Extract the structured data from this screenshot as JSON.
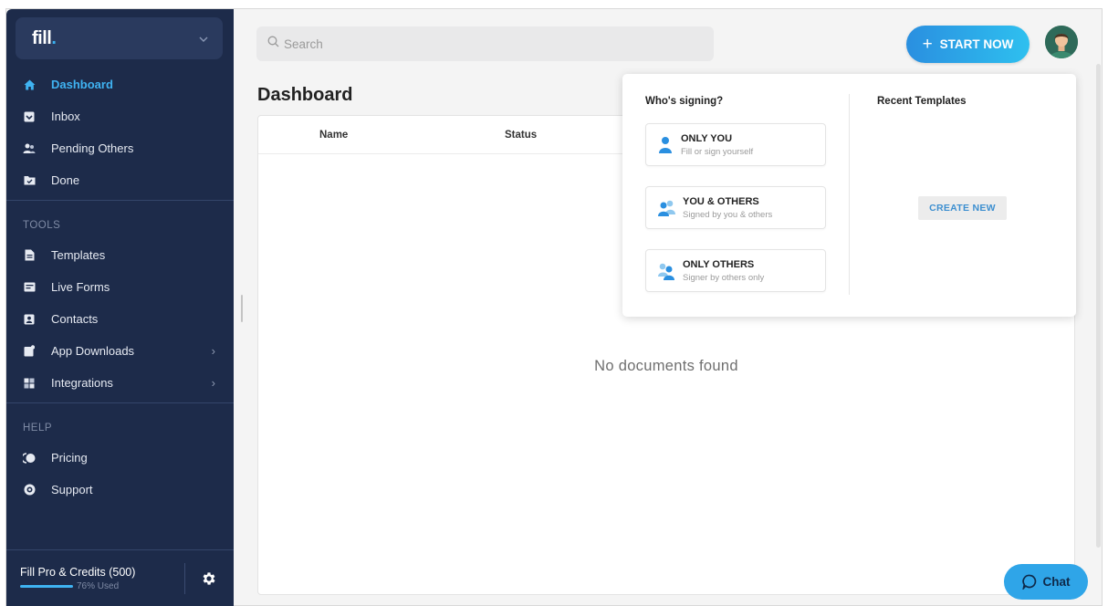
{
  "brand": {
    "logo_text": "fill",
    "logo_dot": "."
  },
  "sidebar": {
    "main_items": [
      {
        "label": "Dashboard",
        "icon": "home-icon",
        "active": true
      },
      {
        "label": "Inbox",
        "icon": "inbox-icon"
      },
      {
        "label": "Pending Others",
        "icon": "users-icon"
      },
      {
        "label": "Done",
        "icon": "folder-check-icon"
      }
    ],
    "tools_title": "TOOLS",
    "tools_items": [
      {
        "label": "Templates",
        "icon": "document-icon"
      },
      {
        "label": "Live Forms",
        "icon": "form-icon"
      },
      {
        "label": "Contacts",
        "icon": "contact-icon"
      },
      {
        "label": "App Downloads",
        "icon": "download-icon",
        "chevron": "›"
      },
      {
        "label": "Integrations",
        "icon": "puzzle-icon",
        "chevron": "›"
      }
    ],
    "help_title": "HELP",
    "help_items": [
      {
        "label": "Pricing",
        "icon": "pricing-icon"
      },
      {
        "label": "Support",
        "icon": "support-icon"
      }
    ],
    "footer": {
      "plan": "Fill Pro & Credits (500)",
      "used": "76% Used",
      "used_fraction": 0.76
    }
  },
  "header": {
    "search_placeholder": "Search",
    "start_label": "START NOW"
  },
  "main": {
    "title": "Dashboard",
    "columns": [
      "Name",
      "Status"
    ],
    "empty_text": "No documents found"
  },
  "dropdown": {
    "signing_title": "Who's signing?",
    "templates_title": "Recent Templates",
    "options": [
      {
        "title": "ONLY YOU",
        "subtitle": "Fill or sign yourself",
        "icon": "single-user-icon"
      },
      {
        "title": "YOU & OTHERS",
        "subtitle": "Signed by you & others",
        "icon": "group-users-icon"
      },
      {
        "title": "ONLY OTHERS",
        "subtitle": "Signer by others only",
        "icon": "others-users-icon"
      }
    ],
    "create_label": "CREATE NEW"
  },
  "chat": {
    "label": "Chat"
  },
  "colors": {
    "sidebar_bg": "#1d2b4a",
    "accent": "#3fb3f2",
    "primary_button": "#2a8fe0"
  }
}
